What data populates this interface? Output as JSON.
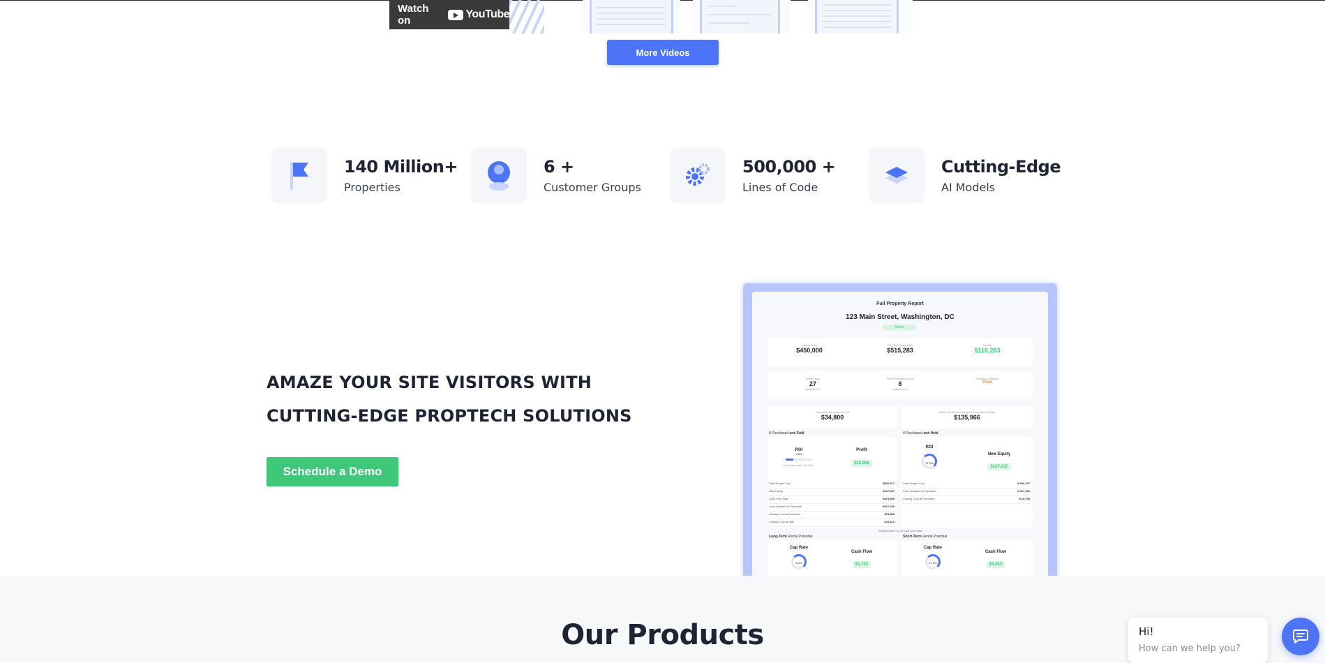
{
  "video": {
    "watch_label": "Watch on",
    "platform": "YouTube"
  },
  "more_videos_label": "More Videos",
  "stats": [
    {
      "value": "140 Million+",
      "label": "Properties",
      "icon": "flag-icon"
    },
    {
      "value": "6 +",
      "label": "Customer Groups",
      "icon": "user-icon"
    },
    {
      "value": "500,000 +",
      "label": "Lines of Code",
      "icon": "gears-icon"
    },
    {
      "value": "Cutting-Edge",
      "label": "AI Models",
      "icon": "layers-icon"
    }
  ],
  "hero": {
    "headline_line1": "AMAZE YOUR SITE VISITORS WITH",
    "headline_line2": "CUTTING-EDGE PROPTECH SOLUTIONS",
    "cta_label": "Schedule a Demo"
  },
  "report": {
    "title": "Full Property Report",
    "address": "123 Main Street, Washington, DC",
    "status": "Active",
    "metrics_top": [
      {
        "label": "Listing Price",
        "value": "$450,000"
      },
      {
        "label": "Full Renovation ARV",
        "value": "$515,283"
      },
      {
        "label": "Upside",
        "value": "$110,283"
      }
    ],
    "metrics_mid": [
      {
        "label": "House Age",
        "value": "27",
        "note": "Optimal: 0-5"
      },
      {
        "label": "Price Flexibility Score",
        "value": "8",
        "note": "Optimal: 10+"
      },
      {
        "label": "Property Condition",
        "value": "Poor"
      }
    ],
    "costs": [
      {
        "label": "Estimated Renovation Cost",
        "value": "$34,800"
      },
      {
        "label": "Maximum Recommended Renovation Budget",
        "value": "$135,966"
      }
    ],
    "sold_section": {
      "prefix": "If Purchased",
      "suffix": "and Sold",
      "roi_label": "ROI",
      "roi_value": "2.6%",
      "roi_note": "Optimal range: 10-15%",
      "profit_label": "Profit",
      "profit_value": "$12,956",
      "rows": [
        {
          "label": "Total Project Cost",
          "value": "$502,317"
        },
        {
          "label": "New Equity",
          "value": "$127,237"
        },
        {
          "label": "Cash from Sale",
          "value": "$474,060"
        },
        {
          "label": "Cash Needed at Purchase",
          "value": "$417,150"
        },
        {
          "label": "Closing Cost at Purchase",
          "value": "$13,500"
        },
        {
          "label": "Closing Cost at Sale",
          "value": "$41,223"
        }
      ]
    },
    "held_section": {
      "prefix": "If Purchased",
      "suffix": "and Held",
      "roi_label": "ROI",
      "roi_value": "27.3%",
      "equity_label": "New Equity",
      "equity_value": "$127,237",
      "rows": [
        {
          "label": "Total Project Cost",
          "value": "$ 502,317"
        },
        {
          "label": "Cash Needed at Purchase",
          "value": "$ 417,150"
        },
        {
          "label": "Closing Cost at Purchase",
          "value": "$ 13,700"
        }
      ]
    },
    "footnote": "*Values based on 3x Cash purchase",
    "long_term": {
      "prefix": "Long-Term",
      "suffix": "Rental Potential",
      "cap_label": "Cap Rate",
      "cap_value": "6.4%",
      "cash_label": "Cash Flow",
      "cash_value": "$1,722"
    },
    "short_term": {
      "prefix": "Short-Term",
      "suffix": "Rental Potential",
      "cap_label": "Cap Rate",
      "cap_value": "11.9%",
      "cash_label": "Cash Flow",
      "cash_value": "$3,432"
    }
  },
  "products_title": "Our Products",
  "chat": {
    "greeting": "Hi!",
    "prompt": "How can we help you?",
    "icon": "chat-icon"
  },
  "colors": {
    "accent_blue": "#4d74f7",
    "cta_green": "#3ec97a",
    "text_dark": "#1f2333"
  }
}
